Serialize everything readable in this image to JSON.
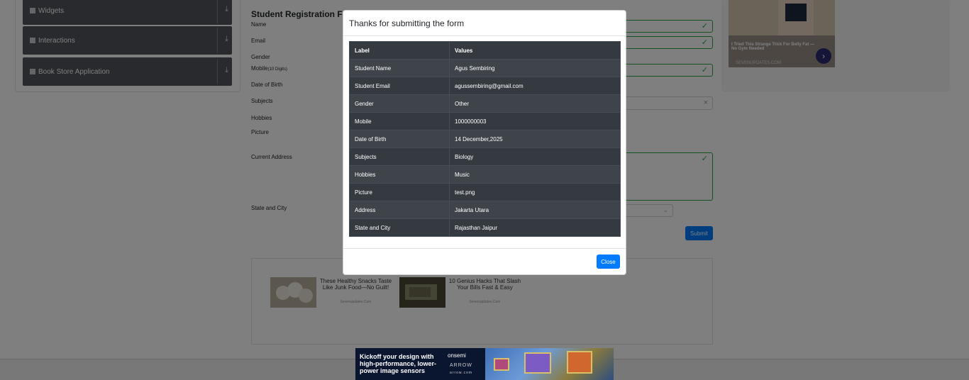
{
  "sidebar": {
    "items": [
      {
        "label": "Widgets",
        "icon": "widgets-icon"
      },
      {
        "label": "Interactions",
        "icon": "interactions-icon"
      },
      {
        "label": "Book Store Application",
        "icon": "book-store-icon"
      }
    ]
  },
  "form": {
    "title": "Student Registration Form",
    "labels": {
      "name": "Name",
      "email": "Email",
      "gender": "Gender",
      "mobile": "Mobile",
      "mobile_hint": "(10 Digits)",
      "dob": "Date of Birth",
      "subjects": "Subjects",
      "hobbies": "Hobbies",
      "picture": "Picture",
      "current_address": "Current Address",
      "state_city": "State and City"
    },
    "submit_label": "Submit",
    "clear_symbol": "×",
    "check_symbol": "✓"
  },
  "right_ad": {
    "caption": "I Tried This Strange Trick For Belly Fat — No Gym Needed",
    "source": "SEVENUPDATES.COM",
    "arrow": "›"
  },
  "content_ads": [
    {
      "title": "These Healthy Snacks Taste Like Junk Food—No Guilt!",
      "source": "Sevenupdates.Com"
    },
    {
      "title": "10 Genius Hacks That Slash Your Bills Fast & Easy",
      "source": "Sevenupdates.Com"
    }
  ],
  "bottom_ad": {
    "text": "Kickoff your design with high-performance, lower-power image sensors",
    "brand": "onsemi",
    "brand2": "ARROW",
    "brand3": "arrow.com"
  },
  "modal": {
    "title": "Thanks for submitting the form",
    "table": {
      "headers": [
        "Label",
        "Values"
      ],
      "rows": [
        [
          "Student Name",
          "Agus Sembiring"
        ],
        [
          "Student Email",
          "agussembiring@gmail.com"
        ],
        [
          "Gender",
          "Other"
        ],
        [
          "Mobile",
          "1000000003"
        ],
        [
          "Date of Birth",
          "14 December,2025"
        ],
        [
          "Subjects",
          "Biology"
        ],
        [
          "Hobbies",
          "Music"
        ],
        [
          "Picture",
          "test.png"
        ],
        [
          "Address",
          "Jakarta Utara"
        ],
        [
          "State and City",
          "Rajasthan Jaipur"
        ]
      ]
    },
    "close_label": "Close"
  },
  "colors": {
    "accent": "#007bff",
    "valid": "#28a745",
    "table_dark": "#343a40",
    "sidebar_item": "#50555b"
  }
}
